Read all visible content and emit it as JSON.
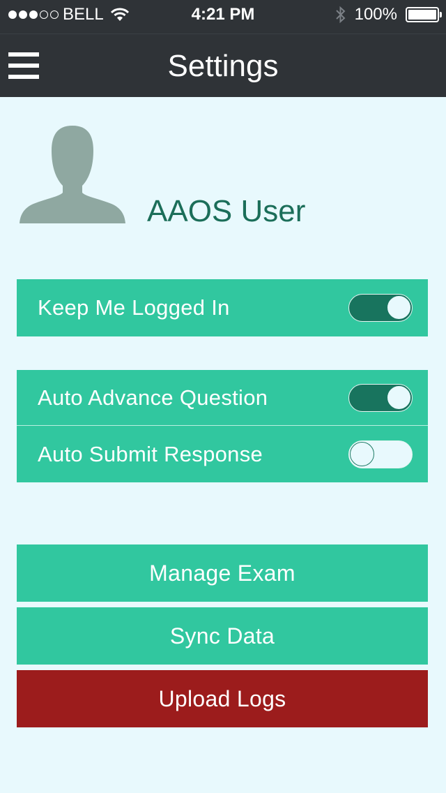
{
  "status_bar": {
    "carrier": "BELL",
    "time": "4:21 PM",
    "battery": "100%",
    "signal_bars_filled": 3,
    "signal_bars_total": 5,
    "icons": [
      "wifi-icon",
      "bluetooth-icon",
      "battery-icon"
    ]
  },
  "nav": {
    "title": "Settings",
    "menu_icon": "hamburger-menu-icon"
  },
  "profile": {
    "name": "AAOS User",
    "avatar_icon": "user-silhouette-icon"
  },
  "settings": {
    "keep_logged_in": {
      "label": "Keep Me Logged In",
      "on": true
    },
    "auto_advance": {
      "label": "Auto Advance Question",
      "on": true
    },
    "auto_submit": {
      "label": "Auto Submit Response",
      "on": false
    }
  },
  "actions": {
    "manage_exam": "Manage Exam",
    "sync_data": "Sync Data",
    "upload_logs": "Upload Logs"
  },
  "colors": {
    "bar_background": "#2f3337",
    "page_background": "#e8f9fd",
    "accent_green": "#31c79f",
    "toggle_on": "#18745e",
    "username_text": "#1b6e59",
    "danger_red": "#9c1c1c",
    "avatar_gray": "#8fa8a1"
  }
}
